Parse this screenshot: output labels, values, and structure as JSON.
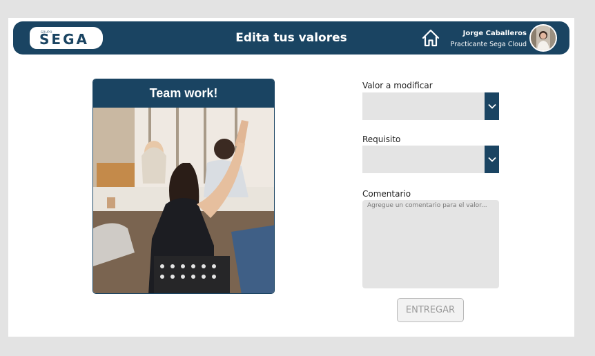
{
  "header": {
    "logo_small": "GRUPO",
    "logo_text": "SEGA",
    "title": "Edita tus valores",
    "home_icon": "home-icon",
    "user_name": "Jorge Caballeros",
    "user_role": "Practicante Sega Cloud"
  },
  "card": {
    "title": "Team work!"
  },
  "form": {
    "valor_label": "Valor a modificar",
    "valor_value": "",
    "requisito_label": "Requisito",
    "requisito_value": "",
    "comentario_label": "Comentario",
    "comentario_placeholder": "Agregue un comentario para el valor...",
    "submit_label": "ENTREGAR",
    "dropdown_icon": "chevron-down-icon"
  },
  "colors": {
    "primary": "#1a4462",
    "field_bg": "#e4e4e4",
    "page_bg": "#e3e3e3"
  }
}
